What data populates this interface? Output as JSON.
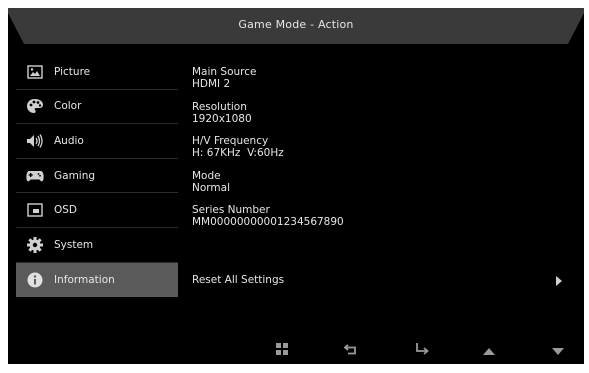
{
  "header": {
    "title": "Game Mode - Action"
  },
  "sidebar": {
    "items": [
      {
        "label": "Picture",
        "icon": "picture-icon"
      },
      {
        "label": "Color",
        "icon": "palette-icon"
      },
      {
        "label": "Audio",
        "icon": "speaker-icon"
      },
      {
        "label": "Gaming",
        "icon": "gamepad-icon"
      },
      {
        "label": "OSD",
        "icon": "osd-icon"
      },
      {
        "label": "System",
        "icon": "gear-icon"
      },
      {
        "label": "Information",
        "icon": "info-icon",
        "active": true
      }
    ]
  },
  "info": {
    "main_source_label": "Main Source",
    "main_source_value": "HDMI 2",
    "resolution_label": "Resolution",
    "resolution_value": "1920x1080",
    "frequency_label": "H/V Frequency",
    "frequency_value": "H: 67KHz  V:60Hz",
    "mode_label": "Mode",
    "mode_value": "Normal",
    "serial_label": "Series Number",
    "serial_value": "MM00000000001234567890"
  },
  "reset": {
    "label": "Reset All Settings"
  },
  "colors": {
    "background": "#000000",
    "title_bar": "#3a3a3a",
    "active_item": "#5a5a5a",
    "text": "#e6e6e6",
    "icon": "#bfbfbf"
  },
  "bottom_buttons": [
    "menu-grid-icon",
    "return-icon",
    "enter-icon",
    "up-arrow-icon",
    "down-arrow-icon"
  ]
}
